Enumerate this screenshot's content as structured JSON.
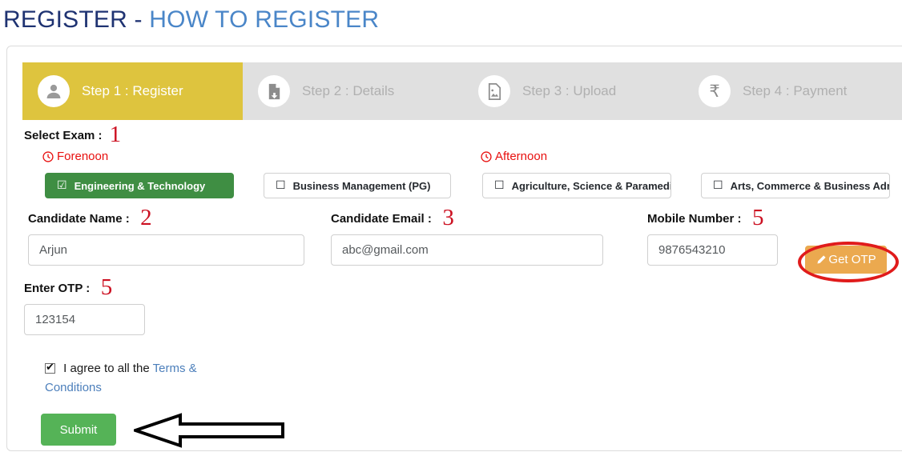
{
  "header": {
    "title_primary": "REGISTER",
    "title_separator": "-",
    "title_secondary": "HOW TO REGISTER"
  },
  "steps": [
    {
      "label": "Step 1 : Register",
      "icon": "user-icon",
      "active": true
    },
    {
      "label": "Step 2 : Details",
      "icon": "file-upload-icon",
      "active": false
    },
    {
      "label": "Step 3 : Upload",
      "icon": "image-file-icon",
      "active": false
    },
    {
      "label": "Step 4 : Payment",
      "icon": "rupee-icon",
      "active": false
    }
  ],
  "exam": {
    "label": "Select Exam :",
    "annotation": "1",
    "sessions": [
      {
        "name": "Forenoon",
        "icon": "clock-icon"
      },
      {
        "name": "Afternoon",
        "icon": "clock-icon"
      }
    ],
    "options": [
      {
        "label": "Engineering & Technology",
        "selected": true,
        "glyph": "☑"
      },
      {
        "label": "Business Management (PG)",
        "selected": false,
        "glyph": "☐"
      },
      {
        "label": "Agriculture, Science & Paramedical",
        "selected": false,
        "glyph": "☐"
      },
      {
        "label": "Arts, Commerce & Business Administration",
        "selected": false,
        "glyph": "☐"
      }
    ]
  },
  "fields": {
    "candidate_name": {
      "label": "Candidate Name :",
      "annotation": "2",
      "value": "Arjun",
      "placeholder": "Candidate Name"
    },
    "candidate_email": {
      "label": "Candidate Email :",
      "annotation": "3",
      "value": "abc@gmail.com",
      "placeholder": "Candidate Email"
    },
    "mobile_number": {
      "label": "Mobile Number :",
      "annotation": "5",
      "value": "9876543210",
      "placeholder": "Mobile Number"
    },
    "otp": {
      "label": "Enter OTP :",
      "annotation": "5",
      "value": "123154",
      "placeholder": "Enter OTP"
    }
  },
  "get_otp": {
    "label": "Get OTP",
    "icon": "pencil-icon"
  },
  "terms": {
    "text_before": "I agree to all the ",
    "link_text": "Terms & Conditions",
    "checked": true
  },
  "submit": {
    "label": "Submit"
  },
  "colors": {
    "step_active_bg": "#dec43e",
    "step_inactive_bg": "#e0e0e0",
    "exam_selected_bg": "#3f8e43",
    "get_otp_bg": "#eba94f",
    "submit_bg": "#55b357",
    "annotation_red": "#cc1122",
    "session_red": "#e8100f",
    "title_dark": "#1f3372",
    "title_light": "#4a86c8",
    "link_blue": "#4c7fbb"
  }
}
